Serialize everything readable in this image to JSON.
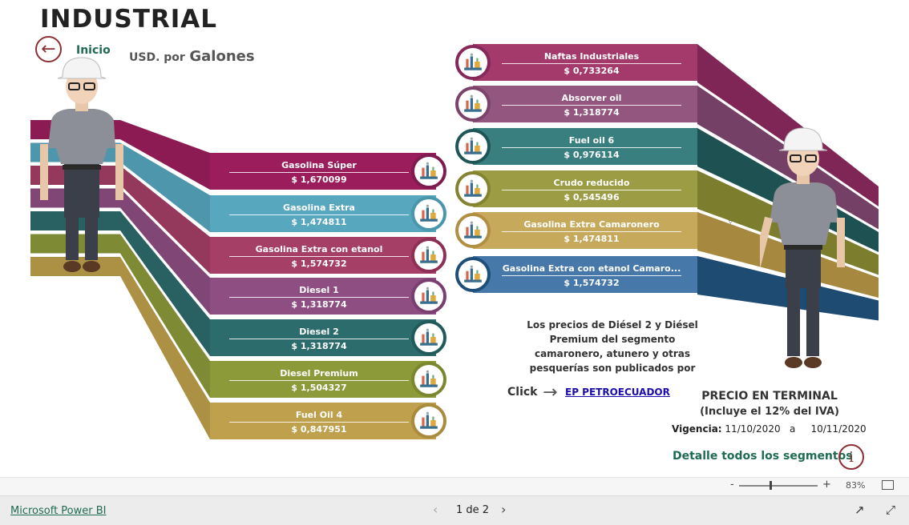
{
  "header": {
    "title": "INDUSTRIAL",
    "back_label": "Inicio",
    "units_small": "USD. por",
    "units_big": "Galones"
  },
  "left_products": [
    {
      "name": "Gasolina Súper",
      "price": "$ 1,670099",
      "color": "#9B1D5C",
      "border": "#7E1B4F"
    },
    {
      "name": "Gasolina Extra",
      "price": "$ 1,474811",
      "color": "#57A7BE",
      "border": "#4A96AC"
    },
    {
      "name": "Gasolina Extra con etanol",
      "price": "$ 1,574732",
      "color": "#A63F66",
      "border": "#8E2F55"
    },
    {
      "name": "Diesel 1",
      "price": "$ 1,318774",
      "color": "#8E4E82",
      "border": "#7A3E70"
    },
    {
      "name": "Diesel 2",
      "price": "$ 1,318774",
      "color": "#2D6C6D",
      "border": "#205A5B"
    },
    {
      "name": "Diesel Premium",
      "price": "$ 1,504327",
      "color": "#8D9A3A",
      "border": "#7A872E"
    },
    {
      "name": "Fuel Oil 4",
      "price": "$ 0,847951",
      "color": "#BFA04C",
      "border": "#A88B3C"
    }
  ],
  "right_products": [
    {
      "name": "Naftas Industriales",
      "price": "$ 0,733264",
      "color": "#A33A6B",
      "border": "#86285A"
    },
    {
      "name": "Absorver oil",
      "price": "$ 1,318774",
      "color": "#93577F",
      "border": "#7B436B"
    },
    {
      "name": "Fuel oil 6",
      "price": "$ 0,976114",
      "color": "#3A7F80",
      "border": "#1E5556"
    },
    {
      "name": "Crudo reducido",
      "price": "$ 0,545496",
      "color": "#9B9C44",
      "border": "#83842F"
    },
    {
      "name": "Gasolina Extra Camaronero",
      "price": "$ 1,474811",
      "color": "#C7A95C",
      "border": "#B08F42"
    },
    {
      "name": "Gasolina Extra con etanol Camaro...",
      "price": "$ 1,574732",
      "color": "#4778AA",
      "border": "#1E4F78"
    }
  ],
  "note": {
    "lines": [
      "Los precios de Diésel 2 y Diésel",
      "Premium del segmento",
      "camaronero, atunero y otras",
      "pesquerías son publicados por"
    ]
  },
  "click_label": "Click",
  "link_label": "EP PETROECUADOR",
  "precio_terminal": "PRECIO EN TERMINAL",
  "iva_note": "(Incluye el 12% del IVA)",
  "vigencia": {
    "label": "Vigencia:",
    "from": "11/10/2020",
    "sep": "a",
    "to": "10/11/2020"
  },
  "detalle_label": "Detalle todos los segmentos",
  "zoom": {
    "minus": "-",
    "plus": "+",
    "level": "83%"
  },
  "footer": {
    "brand": "Microsoft Power BI",
    "page_indicator": "1 de 2"
  },
  "icons": [
    "arrow-left-icon",
    "refinery-icon",
    "arrow-right-icon",
    "info-icon",
    "chevron-left-icon",
    "chevron-right-icon",
    "fit-page-icon",
    "share-icon",
    "expand-icon"
  ]
}
